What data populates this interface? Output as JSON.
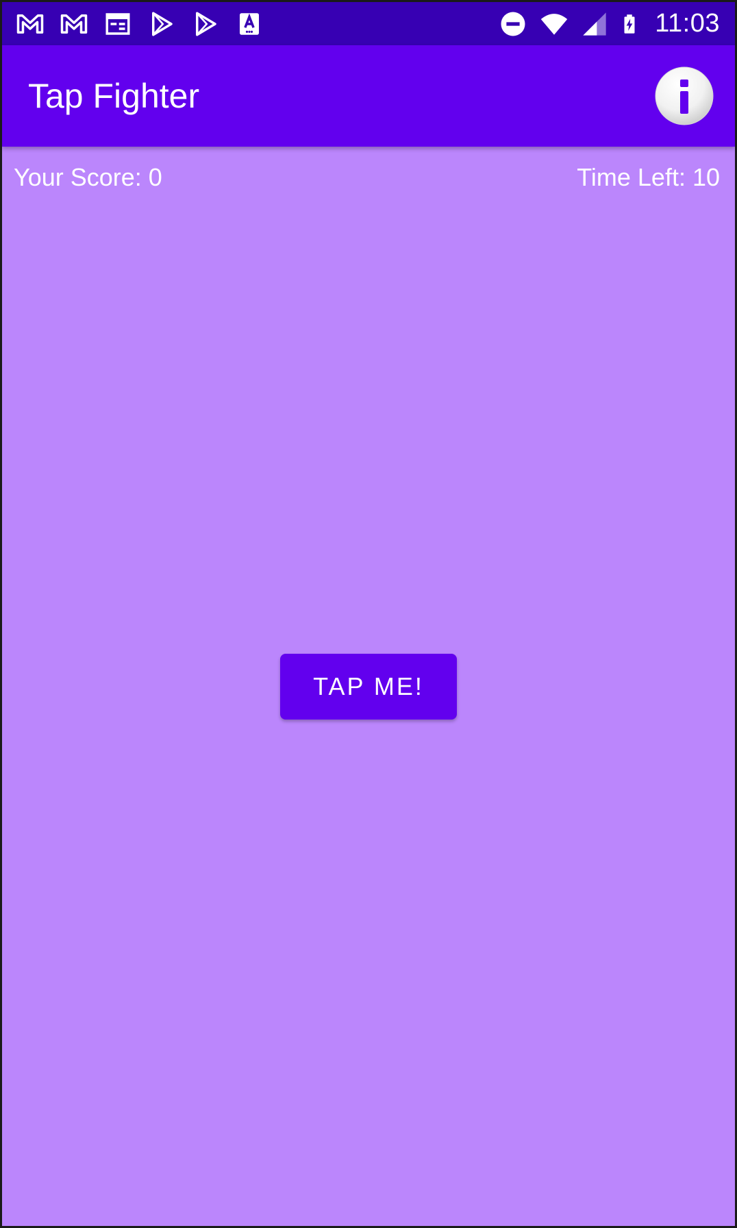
{
  "status_bar": {
    "time": "11:03",
    "notification_icons": [
      "gmail-icon",
      "gmail-icon",
      "calendar-icon",
      "play-store-icon",
      "play-store-icon",
      "font-app-icon"
    ],
    "system_icons": [
      "do-not-disturb-icon",
      "wifi-icon",
      "cellular-signal-icon",
      "battery-charging-icon"
    ]
  },
  "app_bar": {
    "title": "Tap Fighter",
    "info_icon": "info-icon"
  },
  "game": {
    "score_text": "Your Score: 0",
    "time_left_text": "Time Left: 10",
    "tap_button_label": "TAP ME!"
  },
  "colors": {
    "status_bar": "#3700b3",
    "primary": "#6200ee",
    "background": "#bb86fc",
    "text": "#ffffff"
  }
}
